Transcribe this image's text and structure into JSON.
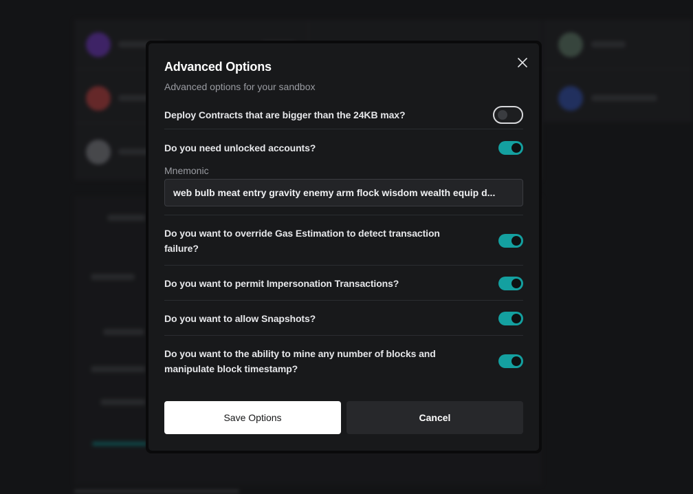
{
  "modal": {
    "title": "Advanced Options",
    "subtitle": "Advanced options for your sandbox",
    "close_icon": "close-icon",
    "options": [
      {
        "id": "large-contracts",
        "label": "Deploy Contracts that are bigger than the 24KB max?",
        "enabled": false
      },
      {
        "id": "unlocked-accounts",
        "label": "Do you need unlocked accounts?",
        "enabled": true
      },
      {
        "id": "gas-estimation",
        "label": "Do you want to override Gas Estimation to detect transaction failure?",
        "enabled": true
      },
      {
        "id": "impersonation",
        "label": "Do you want to permit Impersonation Transactions?",
        "enabled": true
      },
      {
        "id": "snapshots",
        "label": "Do you want to allow Snapshots?",
        "enabled": true
      },
      {
        "id": "mine-blocks",
        "label": "Do you want to the ability to mine any number of blocks and manipulate block timestamp?",
        "enabled": true
      }
    ],
    "mnemonic": {
      "label": "Mnemonic",
      "value": "web bulb meat entry gravity enemy arm flock wisdom wealth equip d..."
    },
    "save_label": "Save Options",
    "cancel_label": "Cancel"
  },
  "colors": {
    "toggle_on": "#14a0a0",
    "modal_bg": "#18191b",
    "page_bg": "#1c1d1f"
  }
}
